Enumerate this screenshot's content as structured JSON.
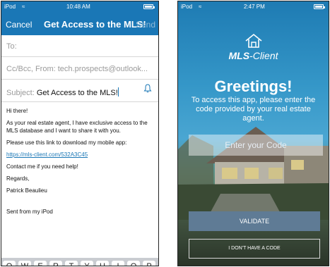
{
  "left": {
    "status": {
      "device": "iPod",
      "time": "10:48 AM"
    },
    "nav": {
      "cancel": "Cancel",
      "title": "Get Access to the MLS!",
      "send": "Send"
    },
    "fields": {
      "to": "To:",
      "cc": "Cc/Bcc, From: tech.prospects@outlook...",
      "subject_label": "Subject: ",
      "subject_value": "Get Access to the MLS!"
    },
    "body": {
      "p1": "Hi there!",
      "p2": "As your real estate agent, I have exclusive access to the MLS database and I want to share it with you.",
      "p3": "Please use this link to download my mobile app:",
      "link": "https://mls-client.com/532A3C45",
      "p4": "Contact me if you need help!",
      "p5": "Regards,",
      "p6": "Patrick Beaulieu",
      "p7": "Sent from my iPod"
    },
    "keyboard": [
      "Q",
      "W",
      "E",
      "R",
      "T",
      "Y",
      "U",
      "I",
      "O",
      "P"
    ]
  },
  "right": {
    "status": {
      "device": "iPod",
      "time": "2:47 PM"
    },
    "brand_bold": "MLS",
    "brand_rest": "-Client",
    "greeting": "Greetings!",
    "instructions": "To access this app, please enter the code provided by your real estate agent.",
    "code_placeholder": "Enter your Code",
    "validate": "VALIDATE",
    "no_code": "I DON'T HAVE A CODE"
  },
  "colors": {
    "mail_bar": "#1a77b6",
    "validate_bg": "#5f7b95"
  }
}
